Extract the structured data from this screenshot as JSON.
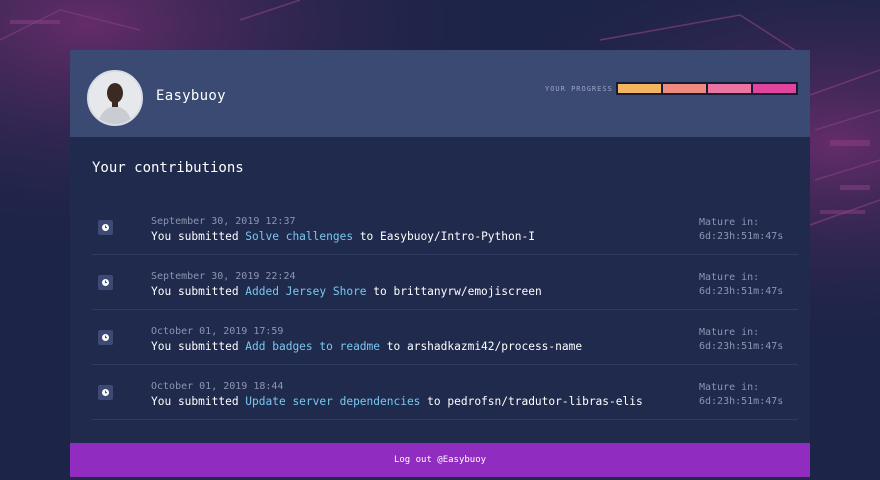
{
  "user": {
    "name": "Easybuoy"
  },
  "progress": {
    "label": "YOUR PROGRESS",
    "segments_total": 4,
    "segments_filled": 4,
    "colors": [
      "#f4b561",
      "#f08a7e",
      "#ec74a2",
      "#e0449f"
    ]
  },
  "contributions": {
    "title": "Your contributions",
    "items": [
      {
        "date": "September 30, 2019 12:37",
        "prefix": "You submitted ",
        "link": "Solve challenges",
        "middle": " to ",
        "repo": "Easybuoy/Intro-Python-I",
        "mature_label": "Mature in:",
        "mature_time": "6d:23h:51m:47s"
      },
      {
        "date": "September 30, 2019 22:24",
        "prefix": "You submitted ",
        "link": "Added Jersey Shore",
        "middle": " to ",
        "repo": "brittanyrw/emojiscreen",
        "mature_label": "Mature in:",
        "mature_time": "6d:23h:51m:47s"
      },
      {
        "date": "October 01, 2019 17:59",
        "prefix": "You submitted ",
        "link": "Add badges to readme",
        "middle": " to ",
        "repo": "arshadkazmi42/process-name",
        "mature_label": "Mature in:",
        "mature_time": "6d:23h:51m:47s"
      },
      {
        "date": "October 01, 2019 18:44",
        "prefix": "You submitted ",
        "link": "Update server dependencies",
        "middle": " to ",
        "repo": "pedrofsn/tradutor-libras-elis",
        "mature_label": "Mature in:",
        "mature_time": "6d:23h:51m:47s"
      }
    ]
  },
  "logout": {
    "label": "Log out @Easybuoy"
  },
  "icons": {
    "row_icon": "clock-icon",
    "avatar": "user-avatar"
  },
  "colors": {
    "background": "#1c2447",
    "card": "#1f2a4d",
    "header": "#3a4a73",
    "link": "#79c8f0",
    "logout": "#902cc0"
  }
}
